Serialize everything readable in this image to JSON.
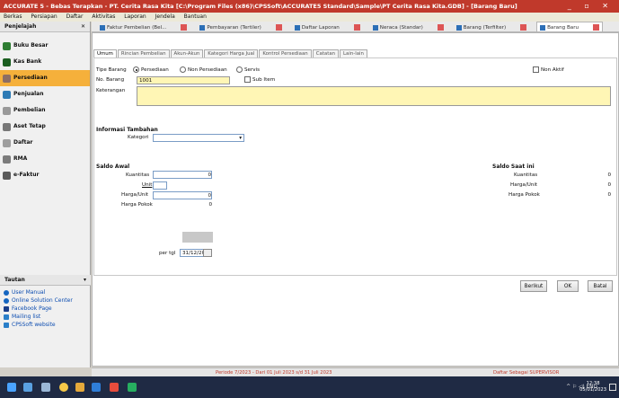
{
  "window": {
    "title": "ACCURATE 5 - Bebas Terapkan - PT. Cerita Rasa Kita  [C:\\Program Files (x86)\\CPSSoft\\ACCURATE5 Standard\\Sample\\PT Cerita Rasa Kita.GDB] - [Barang Baru]",
    "controls": "_ ▫ ✕"
  },
  "menu": [
    "Berkas",
    "Persiapan",
    "Daftar",
    "Aktivitas",
    "Laporan",
    "Jendela",
    "Bantuan"
  ],
  "sidebar": {
    "header": "Penjelajah",
    "close": "✕",
    "items": [
      {
        "label": "Buku Besar",
        "icon": "ledger-icon"
      },
      {
        "label": "Kas Bank",
        "icon": "bank-icon"
      },
      {
        "label": "Persediaan",
        "icon": "inventory-icon"
      },
      {
        "label": "Penjualan",
        "icon": "sales-icon"
      },
      {
        "label": "Pembelian",
        "icon": "purchase-icon"
      },
      {
        "label": "Aset Tetap",
        "icon": "asset-icon"
      },
      {
        "label": "Daftar",
        "icon": "list-icon"
      },
      {
        "label": "RMA",
        "icon": "rma-icon"
      },
      {
        "label": "e-Faktur",
        "icon": "efaktur-icon"
      }
    ],
    "active_index": 2
  },
  "links": {
    "header": "Tautan",
    "items": [
      "User Manual",
      "Online Solution Center",
      "Facebook Page",
      "Mailing list",
      "CPSSoft website"
    ]
  },
  "doc_tabs": [
    "Faktur Pembelian (Bel...",
    "Pembayaran (Tertiler)",
    "Daftar Laporan",
    "Neraca (Standar)",
    "Barang (Terfilter)",
    "Barang Baru"
  ],
  "sub_tabs": [
    "Umum",
    "Rincian Pembelian",
    "Akun-Akun",
    "Kategori Harga Jual",
    "Kontrol Persediaan",
    "Catatan",
    "Lain-lain"
  ],
  "form": {
    "tipe_barang_label": "Tipe Barang",
    "radio_options": [
      "Persediaan",
      "Non Persediaan",
      "Servis"
    ],
    "selected_radio": 0,
    "non_aktif_label": "Non Aktif",
    "no_barang_label": "No. Barang",
    "no_barang_value": "1001",
    "sub_item_label": "Sub Item",
    "keterangan_label": "Keterangan",
    "keterangan_value": "",
    "info_tambahan": "Informasi Tambahan",
    "kategori_label": "Kategori",
    "kategori_value": "",
    "saldo_awal": "Saldo Awal",
    "kuantitas_label": "Kuantitas",
    "kuantitas_value": "0",
    "unit_label": "Unit",
    "unit_value": "",
    "harga_unit_label": "Harga/Unit",
    "harga_unit_value": "0",
    "harga_pokok_label": "Harga Pokok",
    "harga_pokok_value": "0",
    "per_tgl_label": "per tgl",
    "per_tgl_value": "31/12/2022",
    "saldo_saat_ini": "Saldo Saat ini",
    "cur_kuantitas_label": "Kuantitas",
    "cur_kuantitas_value": "0",
    "cur_harga_unit_label": "Harga/Unit",
    "cur_harga_unit_value": "0",
    "cur_harga_pokok_label": "Harga Pokok",
    "cur_harga_pokok_value": "0"
  },
  "buttons": {
    "lanjut": "Berikut",
    "ok": "OK",
    "batal": "Batal"
  },
  "status": {
    "periode": "Periode 7/2023 - Dari 01 Juli 2023 s/d 31 Juli 2023",
    "user": "Daftar Sebagai SUPERVISOR"
  },
  "taskbar": {
    "tray": "^  ⚐  ◁) ENG",
    "time": "12:38",
    "date": "05/01/2023"
  },
  "colors": {
    "title": "#c0392b",
    "active_nav": "#f5b03b",
    "yellow_field": "#fff6b5"
  }
}
